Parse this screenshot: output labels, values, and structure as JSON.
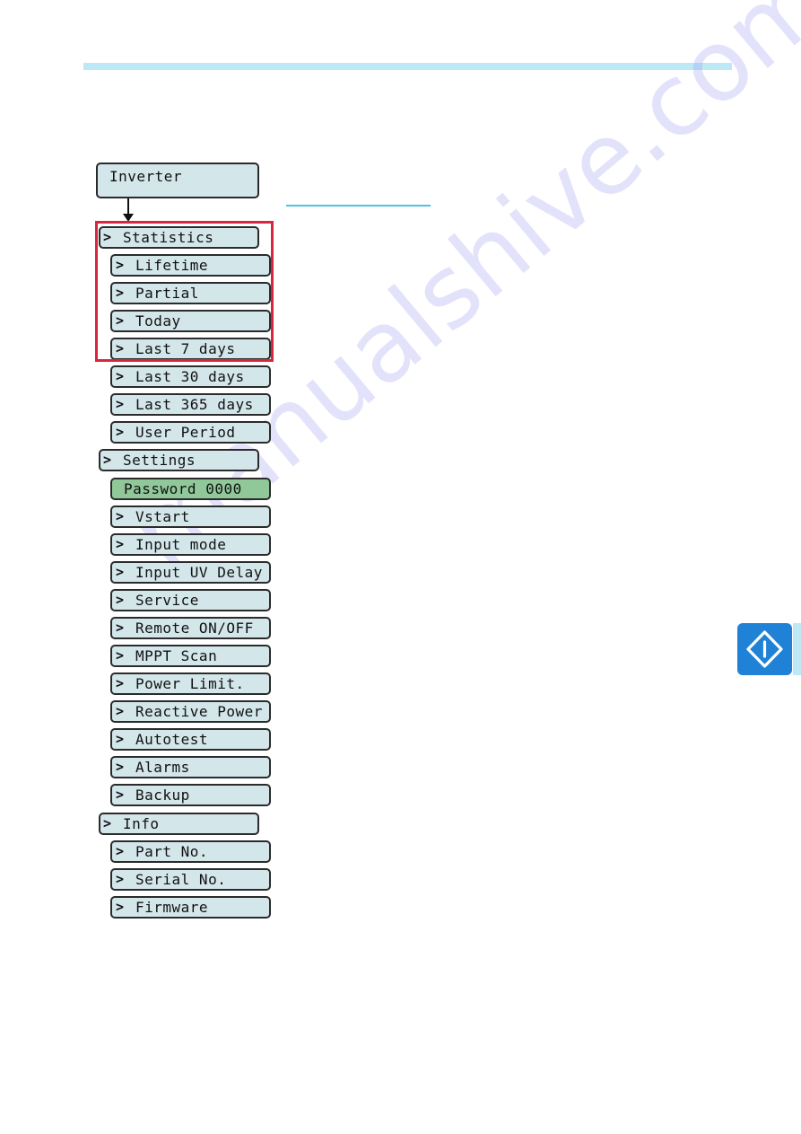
{
  "page": {
    "colors": {
      "header_bar": "#bde8f6",
      "title_rule": "#4fc3e0",
      "lcd_background": "#d3e6ea",
      "lcd_selected": "#90c89a",
      "highlight_border": "#d7263d",
      "badge": "#1f82d6"
    },
    "watermark": "manualshive.com"
  },
  "menu": {
    "root": "Inverter",
    "chevron": ">",
    "sections": [
      {
        "label": "Statistics",
        "highlighted": true,
        "items": [
          "Lifetime",
          "Partial",
          "Today",
          "Last 7 days",
          "Last 30 days",
          "Last 365 days",
          "User Period"
        ]
      },
      {
        "label": "Settings",
        "password": "Password 0000",
        "items": [
          "Vstart",
          "Input mode",
          "Input UV Delay",
          "Service",
          "Remote ON/OFF",
          "MPPT Scan",
          "Power Limit.",
          "Reactive Power",
          "Autotest",
          "Alarms",
          "Backup"
        ]
      },
      {
        "label": "Info",
        "items": [
          "Part No.",
          "Serial No.",
          "Firmware"
        ]
      }
    ]
  },
  "side_badge": {
    "icon": "info-diamond-icon"
  }
}
